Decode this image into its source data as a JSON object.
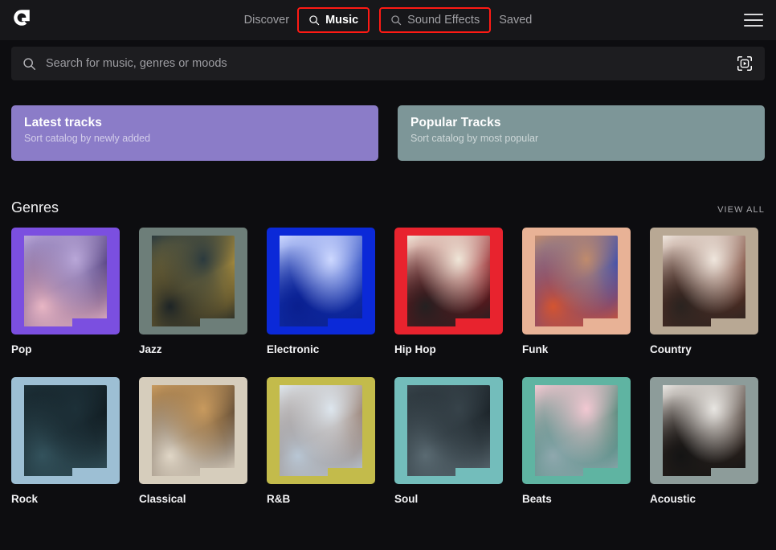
{
  "theme": {
    "page_bg": "#0d0d10",
    "topbar_bg": "#17171a",
    "search_bg": "#1d1d20",
    "annotation_color": "#ff1a14",
    "text_primary": "#ffffff",
    "text_muted": "#a0a0a4"
  },
  "topbar": {
    "logo_icon": "logo-icon",
    "menu_icon": "hamburger-menu-icon",
    "nav_items": [
      {
        "label": "Discover",
        "icon": null,
        "active": false,
        "highlighted": false
      },
      {
        "label": "Music",
        "icon": "search-icon",
        "active": true,
        "highlighted": true
      },
      {
        "label": "Sound Effects",
        "icon": "search-icon",
        "active": false,
        "highlighted": true
      },
      {
        "label": "Saved",
        "icon": null,
        "active": false,
        "highlighted": false
      }
    ]
  },
  "search": {
    "placeholder": "Search for music, genres or moods",
    "value": "",
    "left_icon": "search-icon",
    "right_icon": "scan-media-icon"
  },
  "sort_cards": [
    {
      "title": "Latest tracks",
      "subtitle": "Sort catalog by newly added",
      "bg": "#8b7cc8"
    },
    {
      "title": "Popular Tracks",
      "subtitle": "Sort catalog by most popular",
      "bg": "#7d9698"
    }
  ],
  "genres_section": {
    "title": "Genres",
    "view_all_label": "VIEW ALL"
  },
  "genres": [
    {
      "label": "Pop",
      "bg": "#7b4fe0",
      "img_a": "#b9a7d8",
      "img_b": "#3d2a6b",
      "img_c": "#e8b6c4"
    },
    {
      "label": "Jazz",
      "bg": "#6d7e79",
      "img_a": "#2b3a3e",
      "img_b": "#c9a13a",
      "img_c": "#1d2426"
    },
    {
      "label": "Electronic",
      "bg": "#0b29d8",
      "img_a": "#cdd8ff",
      "img_b": "#1437b8",
      "img_c": "#0a1f8f"
    },
    {
      "label": "Hip Hop",
      "bg": "#e8232e",
      "img_a": "#efe6d8",
      "img_b": "#8d1018",
      "img_c": "#242021"
    },
    {
      "label": "Funk",
      "bg": "#e8b296",
      "img_a": "#c08b6c",
      "img_b": "#1b3fc0",
      "img_c": "#d45430"
    },
    {
      "label": "Country",
      "bg": "#b8a894",
      "img_a": "#efe6dd",
      "img_b": "#6d3526",
      "img_c": "#2a2320"
    },
    {
      "label": "Rock",
      "bg": "#9dbfd4",
      "img_a": "#1d3038",
      "img_b": "#0d161b",
      "img_c": "#33525c"
    },
    {
      "label": "Classical",
      "bg": "#d6cdbc",
      "img_a": "#c89a5e",
      "img_b": "#4a3a2c",
      "img_c": "#e0d6c6"
    },
    {
      "label": "R&B",
      "bg": "#c3bb4b",
      "img_a": "#dde6ee",
      "img_b": "#8a6a58",
      "img_c": "#b8c6d4"
    },
    {
      "label": "Soul",
      "bg": "#73bdbb",
      "img_a": "#37434a",
      "img_b": "#131a1f",
      "img_c": "#5a6a72"
    },
    {
      "label": "Beats",
      "bg": "#5fb4a2",
      "img_a": "#f2c8d2",
      "img_b": "#2f7a66",
      "img_c": "#8fa8ae"
    },
    {
      "label": "Acoustic",
      "bg": "#8d9c9a",
      "img_a": "#e8e6e2",
      "img_b": "#3a2a22",
      "img_c": "#141414"
    }
  ]
}
